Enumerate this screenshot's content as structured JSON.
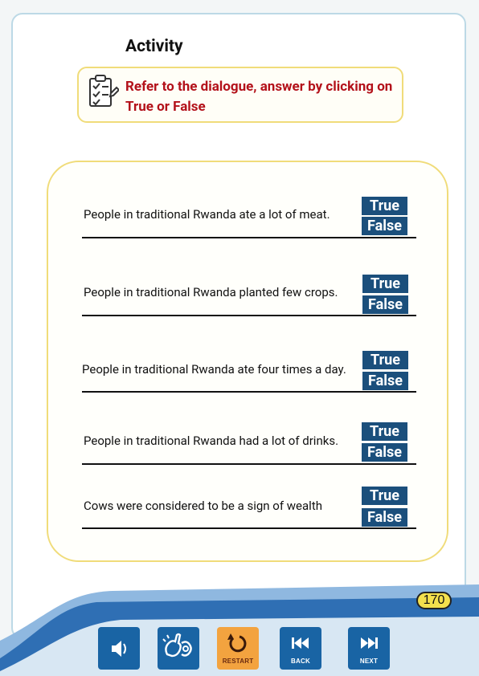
{
  "activity": {
    "title": "Activity",
    "instruction": "Refer to the dialogue, answer by clicking on True or False"
  },
  "questions": [
    {
      "text": "People in traditional Rwanda ate a lot of meat.",
      "true_label": "True",
      "false_label": "False"
    },
    {
      "text": "People in traditional Rwanda planted few crops.",
      "true_label": "True",
      "false_label": "False"
    },
    {
      "text": "People in traditional Rwanda ate four times a day.",
      "true_label": "True",
      "false_label": "False"
    },
    {
      "text": "People in traditional Rwanda had a lot of drinks.",
      "true_label": "True",
      "false_label": "False"
    },
    {
      "text": "Cows were considered to be a sign of wealth",
      "true_label": "True",
      "false_label": "False"
    }
  ],
  "page": {
    "number": "170"
  },
  "nav": {
    "audio_icon": "speaker-icon",
    "sign_icon": "sign-language-icon",
    "restart_label": "RESTART",
    "back_label": "BACK",
    "next_label": "NEXT"
  },
  "colors": {
    "button_blue": "#1b4f7c",
    "nav_blue": "#1964a4",
    "restart_orange": "#f3a33f",
    "instruction_red": "#b3111a",
    "panel_border": "#f0dc7a"
  }
}
